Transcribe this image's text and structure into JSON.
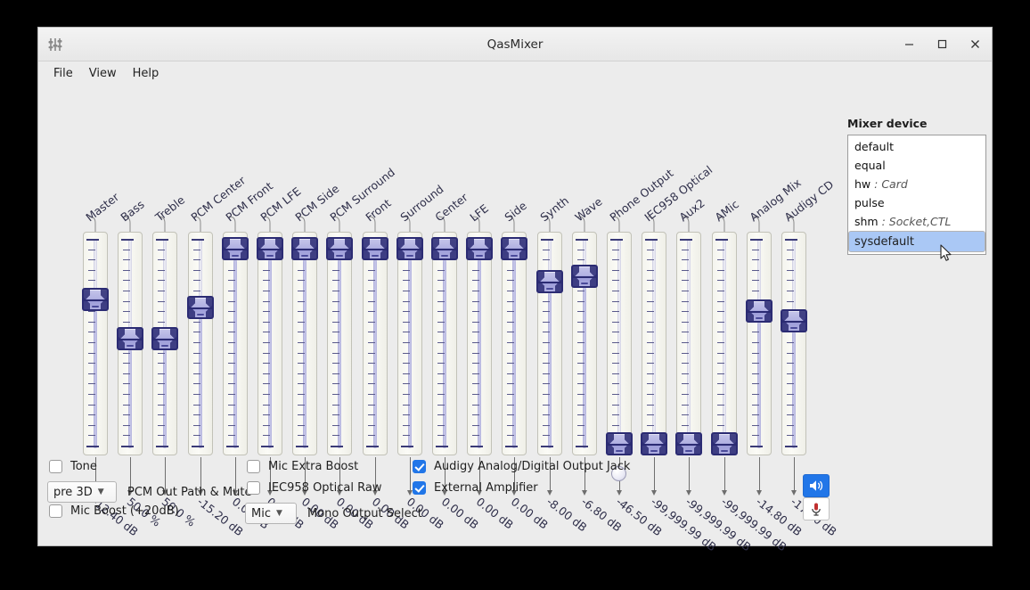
{
  "window": {
    "title": "QasMixer",
    "app_icon": "mixer-sliders-icon",
    "minimize": "−",
    "maximize": "☐",
    "close": "✕"
  },
  "menubar": {
    "items": [
      "File",
      "View",
      "Help"
    ]
  },
  "mixer_device": {
    "label": "Mixer device",
    "options": [
      {
        "name": "default",
        "sub": ""
      },
      {
        "name": "equal",
        "sub": ""
      },
      {
        "name": "hw",
        "sub": ": Card"
      },
      {
        "name": "pulse",
        "sub": ""
      },
      {
        "name": "shm",
        "sub": ": Socket,CTL"
      },
      {
        "name": "sysdefault",
        "sub": ""
      }
    ],
    "selected": "sysdefault",
    "cursor_icon": "mouse-pointer-icon"
  },
  "sliders": [
    {
      "label": "Master",
      "value": "-12.40 dB",
      "pct": 74,
      "max": false
    },
    {
      "label": "Bass",
      "value": "50.0 %",
      "pct": 54,
      "max": false
    },
    {
      "label": "Treble",
      "value": "50.0 %",
      "pct": 54,
      "max": false
    },
    {
      "label": "PCM Center",
      "value": "-15.20 dB",
      "pct": 70,
      "max": false
    },
    {
      "label": "PCM Front",
      "value": "0.00 dB",
      "pct": 100,
      "max": true
    },
    {
      "label": "PCM LFE",
      "value": "0.00 dB",
      "pct": 100,
      "max": true
    },
    {
      "label": "PCM Side",
      "value": "0.00 dB",
      "pct": 100,
      "max": true
    },
    {
      "label": "PCM Surround",
      "value": "0.00 dB",
      "pct": 100,
      "max": true
    },
    {
      "label": "Front",
      "value": "0.00 dB",
      "pct": 100,
      "max": true
    },
    {
      "label": "Surround",
      "value": "0.00 dB",
      "pct": 100,
      "max": true
    },
    {
      "label": "Center",
      "value": "0.00 dB",
      "pct": 100,
      "max": true
    },
    {
      "label": "LFE",
      "value": "0.00 dB",
      "pct": 100,
      "max": true
    },
    {
      "label": "Side",
      "value": "0.00 dB",
      "pct": 100,
      "max": true
    },
    {
      "label": "Synth",
      "value": "-8.00 dB",
      "pct": 83,
      "max": false
    },
    {
      "label": "Wave",
      "value": "-6.80 dB",
      "pct": 86,
      "max": false
    },
    {
      "label": "Phone Output",
      "value": "-46.50 dB",
      "pct": 0,
      "max": false
    },
    {
      "label": "IEC958 Optical",
      "value": "-99,999.99 dB",
      "pct": 0,
      "max": false
    },
    {
      "label": "Aux2",
      "value": "-99,999.99 dB",
      "pct": 0,
      "max": false
    },
    {
      "label": "AMic",
      "value": "-99,999.99 dB",
      "pct": 0,
      "max": false
    },
    {
      "label": "Analog Mix",
      "value": "-14.80 dB",
      "pct": 68,
      "max": false
    },
    {
      "label": "Audigy CD",
      "value": "-17.20 dB",
      "pct": 63,
      "max": false
    }
  ],
  "controls": {
    "tone": {
      "label": "Tone",
      "checked": false
    },
    "mic_boost": {
      "label": "Mic Boost (+20dB)",
      "checked": false
    },
    "pcm_out_select": {
      "value": "pre 3D",
      "label": "PCM Out Path & Mute"
    },
    "mic_extra_boost": {
      "label": "Mic Extra Boost",
      "checked": false
    },
    "iec958_raw": {
      "label": "IEC958 Optical Raw",
      "checked": false
    },
    "mono_out_select": {
      "value": "Mic",
      "label": "Mono Output Select"
    },
    "audigy_jack": {
      "label": "Audigy Analog/Digital Output Jack",
      "checked": true
    },
    "external_amp": {
      "label": "External Amplifier",
      "checked": true
    },
    "speaker_button": {
      "icon": "speaker-icon",
      "active": true
    },
    "mic_button": {
      "icon": "microphone-icon",
      "active": false
    }
  },
  "colors": {
    "accent": "#2176e8",
    "handle_border": "#2b2b73",
    "selection": "#aac8f5",
    "window_bg": "#ececec"
  }
}
